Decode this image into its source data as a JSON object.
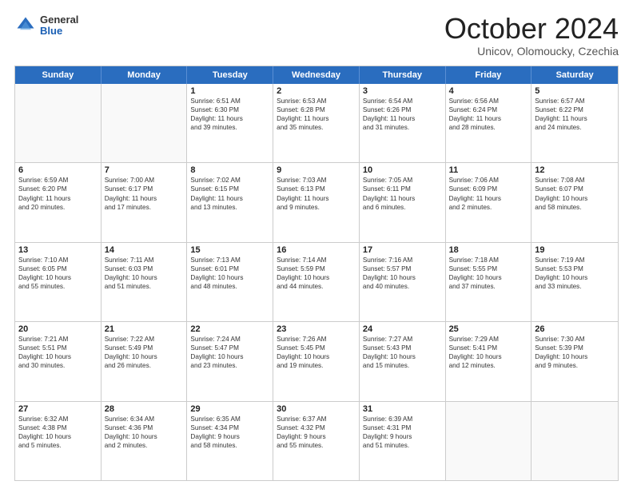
{
  "header": {
    "logo_general": "General",
    "logo_blue": "Blue",
    "title": "October 2024",
    "location": "Unicov, Olomoucky, Czechia"
  },
  "days_of_week": [
    "Sunday",
    "Monday",
    "Tuesday",
    "Wednesday",
    "Thursday",
    "Friday",
    "Saturday"
  ],
  "weeks": [
    [
      {
        "day": "",
        "sunrise": "",
        "sunset": "",
        "daylight": ""
      },
      {
        "day": "",
        "sunrise": "",
        "sunset": "",
        "daylight": ""
      },
      {
        "day": "1",
        "sunrise": "Sunrise: 6:51 AM",
        "sunset": "Sunset: 6:30 PM",
        "daylight": "Daylight: 11 hours and 39 minutes."
      },
      {
        "day": "2",
        "sunrise": "Sunrise: 6:53 AM",
        "sunset": "Sunset: 6:28 PM",
        "daylight": "Daylight: 11 hours and 35 minutes."
      },
      {
        "day": "3",
        "sunrise": "Sunrise: 6:54 AM",
        "sunset": "Sunset: 6:26 PM",
        "daylight": "Daylight: 11 hours and 31 minutes."
      },
      {
        "day": "4",
        "sunrise": "Sunrise: 6:56 AM",
        "sunset": "Sunset: 6:24 PM",
        "daylight": "Daylight: 11 hours and 28 minutes."
      },
      {
        "day": "5",
        "sunrise": "Sunrise: 6:57 AM",
        "sunset": "Sunset: 6:22 PM",
        "daylight": "Daylight: 11 hours and 24 minutes."
      }
    ],
    [
      {
        "day": "6",
        "sunrise": "Sunrise: 6:59 AM",
        "sunset": "Sunset: 6:20 PM",
        "daylight": "Daylight: 11 hours and 20 minutes."
      },
      {
        "day": "7",
        "sunrise": "Sunrise: 7:00 AM",
        "sunset": "Sunset: 6:17 PM",
        "daylight": "Daylight: 11 hours and 17 minutes."
      },
      {
        "day": "8",
        "sunrise": "Sunrise: 7:02 AM",
        "sunset": "Sunset: 6:15 PM",
        "daylight": "Daylight: 11 hours and 13 minutes."
      },
      {
        "day": "9",
        "sunrise": "Sunrise: 7:03 AM",
        "sunset": "Sunset: 6:13 PM",
        "daylight": "Daylight: 11 hours and 9 minutes."
      },
      {
        "day": "10",
        "sunrise": "Sunrise: 7:05 AM",
        "sunset": "Sunset: 6:11 PM",
        "daylight": "Daylight: 11 hours and 6 minutes."
      },
      {
        "day": "11",
        "sunrise": "Sunrise: 7:06 AM",
        "sunset": "Sunset: 6:09 PM",
        "daylight": "Daylight: 11 hours and 2 minutes."
      },
      {
        "day": "12",
        "sunrise": "Sunrise: 7:08 AM",
        "sunset": "Sunset: 6:07 PM",
        "daylight": "Daylight: 10 hours and 58 minutes."
      }
    ],
    [
      {
        "day": "13",
        "sunrise": "Sunrise: 7:10 AM",
        "sunset": "Sunset: 6:05 PM",
        "daylight": "Daylight: 10 hours and 55 minutes."
      },
      {
        "day": "14",
        "sunrise": "Sunrise: 7:11 AM",
        "sunset": "Sunset: 6:03 PM",
        "daylight": "Daylight: 10 hours and 51 minutes."
      },
      {
        "day": "15",
        "sunrise": "Sunrise: 7:13 AM",
        "sunset": "Sunset: 6:01 PM",
        "daylight": "Daylight: 10 hours and 48 minutes."
      },
      {
        "day": "16",
        "sunrise": "Sunrise: 7:14 AM",
        "sunset": "Sunset: 5:59 PM",
        "daylight": "Daylight: 10 hours and 44 minutes."
      },
      {
        "day": "17",
        "sunrise": "Sunrise: 7:16 AM",
        "sunset": "Sunset: 5:57 PM",
        "daylight": "Daylight: 10 hours and 40 minutes."
      },
      {
        "day": "18",
        "sunrise": "Sunrise: 7:18 AM",
        "sunset": "Sunset: 5:55 PM",
        "daylight": "Daylight: 10 hours and 37 minutes."
      },
      {
        "day": "19",
        "sunrise": "Sunrise: 7:19 AM",
        "sunset": "Sunset: 5:53 PM",
        "daylight": "Daylight: 10 hours and 33 minutes."
      }
    ],
    [
      {
        "day": "20",
        "sunrise": "Sunrise: 7:21 AM",
        "sunset": "Sunset: 5:51 PM",
        "daylight": "Daylight: 10 hours and 30 minutes."
      },
      {
        "day": "21",
        "sunrise": "Sunrise: 7:22 AM",
        "sunset": "Sunset: 5:49 PM",
        "daylight": "Daylight: 10 hours and 26 minutes."
      },
      {
        "day": "22",
        "sunrise": "Sunrise: 7:24 AM",
        "sunset": "Sunset: 5:47 PM",
        "daylight": "Daylight: 10 hours and 23 minutes."
      },
      {
        "day": "23",
        "sunrise": "Sunrise: 7:26 AM",
        "sunset": "Sunset: 5:45 PM",
        "daylight": "Daylight: 10 hours and 19 minutes."
      },
      {
        "day": "24",
        "sunrise": "Sunrise: 7:27 AM",
        "sunset": "Sunset: 5:43 PM",
        "daylight": "Daylight: 10 hours and 15 minutes."
      },
      {
        "day": "25",
        "sunrise": "Sunrise: 7:29 AM",
        "sunset": "Sunset: 5:41 PM",
        "daylight": "Daylight: 10 hours and 12 minutes."
      },
      {
        "day": "26",
        "sunrise": "Sunrise: 7:30 AM",
        "sunset": "Sunset: 5:39 PM",
        "daylight": "Daylight: 10 hours and 9 minutes."
      }
    ],
    [
      {
        "day": "27",
        "sunrise": "Sunrise: 6:32 AM",
        "sunset": "Sunset: 4:38 PM",
        "daylight": "Daylight: 10 hours and 5 minutes."
      },
      {
        "day": "28",
        "sunrise": "Sunrise: 6:34 AM",
        "sunset": "Sunset: 4:36 PM",
        "daylight": "Daylight: 10 hours and 2 minutes."
      },
      {
        "day": "29",
        "sunrise": "Sunrise: 6:35 AM",
        "sunset": "Sunset: 4:34 PM",
        "daylight": "Daylight: 9 hours and 58 minutes."
      },
      {
        "day": "30",
        "sunrise": "Sunrise: 6:37 AM",
        "sunset": "Sunset: 4:32 PM",
        "daylight": "Daylight: 9 hours and 55 minutes."
      },
      {
        "day": "31",
        "sunrise": "Sunrise: 6:39 AM",
        "sunset": "Sunset: 4:31 PM",
        "daylight": "Daylight: 9 hours and 51 minutes."
      },
      {
        "day": "",
        "sunrise": "",
        "sunset": "",
        "daylight": ""
      },
      {
        "day": "",
        "sunrise": "",
        "sunset": "",
        "daylight": ""
      }
    ]
  ]
}
